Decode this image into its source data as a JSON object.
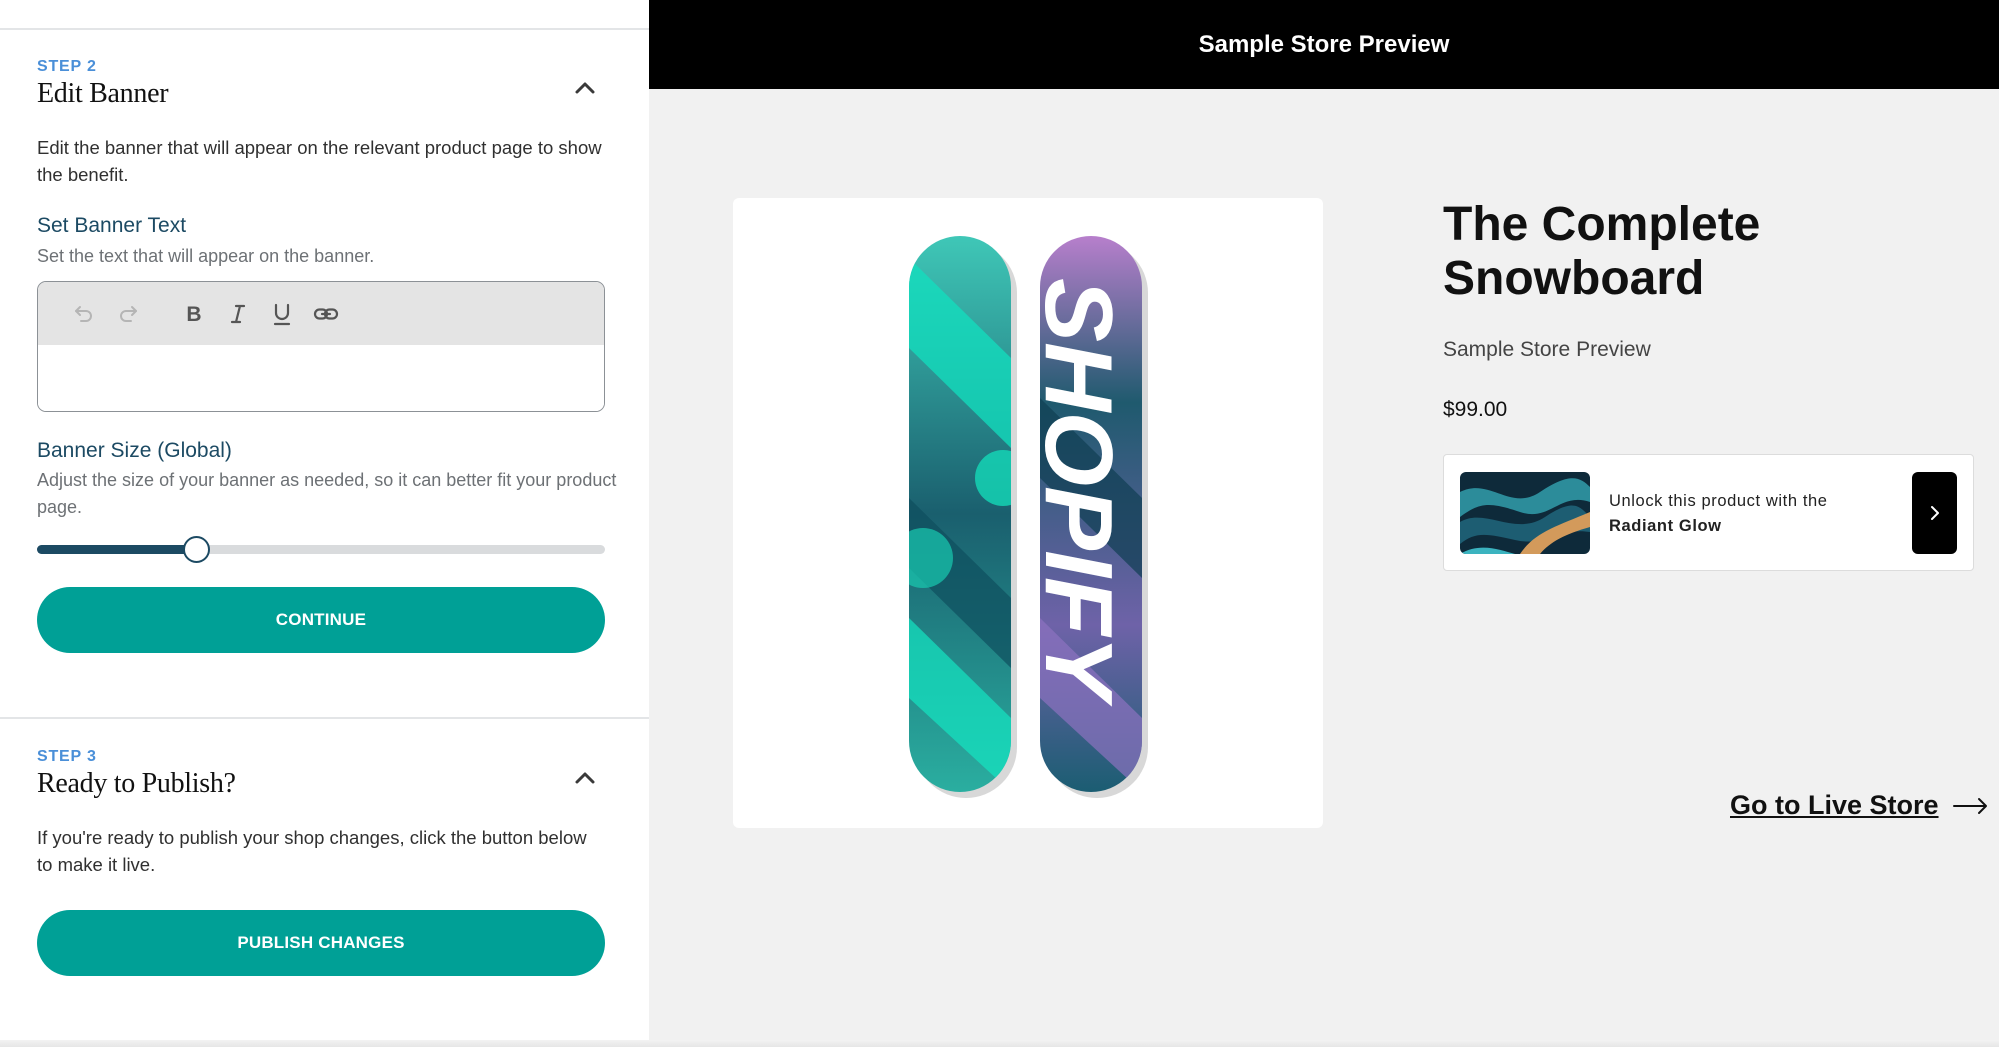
{
  "left_panel": {
    "step2": {
      "step_label": "STEP 2",
      "title": "Edit Banner",
      "description": "Edit the banner that will appear on the relevant product page to show the benefit.",
      "banner_text": {
        "title": "Set Banner Text",
        "help": "Set the text that will appear on the banner.",
        "value": "",
        "toolbar": [
          "undo-icon",
          "redo-icon",
          "bold-icon",
          "italic-icon",
          "underline-icon",
          "link-icon"
        ]
      },
      "banner_size": {
        "title": "Banner Size (Global)",
        "help": "Adjust the size of your banner as needed, so it can better fit your product page.",
        "value_fraction": 0.28
      },
      "continue_label": "CONTINUE"
    },
    "step3": {
      "step_label": "STEP 3",
      "title": "Ready to Publish?",
      "description": "If you're ready to publish your shop changes, click the button below to make it live.",
      "publish_label": "PUBLISH CHANGES"
    }
  },
  "preview": {
    "header": "Sample Store Preview",
    "product": {
      "title": "The Complete Snowboard",
      "vendor": "Sample Store Preview",
      "price": "$99.00",
      "board_graphic_text": "SHOPIFY"
    },
    "banner": {
      "text_prefix": "Unlock this product with the ",
      "text_bold": "Radiant Glow"
    },
    "live_store_label": "Go to Live Store"
  },
  "colors": {
    "accent": "#00a096",
    "heading_blue": "#1c4a63",
    "step_blue": "#4a8fd8",
    "header_bg": "#000000",
    "preview_bg": "#f1f1f1"
  }
}
